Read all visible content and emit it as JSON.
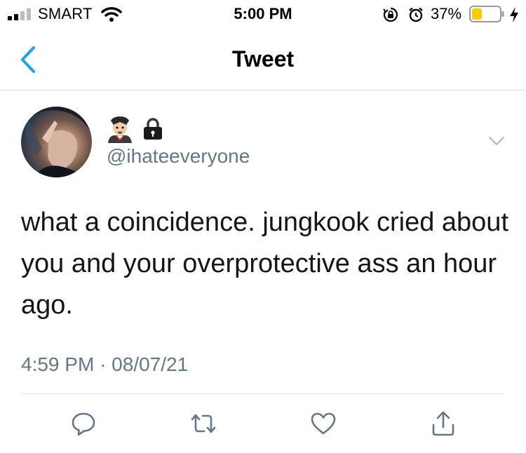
{
  "status_bar": {
    "carrier": "SMART",
    "time": "5:00 PM",
    "battery_percent": "37%",
    "battery_level": 0.37,
    "battery_color": "#ffcc00",
    "icons": [
      "signal-icon",
      "wifi-icon",
      "orientation-lock-icon",
      "alarm-icon",
      "battery-icon",
      "charging-icon"
    ]
  },
  "nav": {
    "title": "Tweet",
    "back_icon": "chevron-left-icon",
    "accent": "#1da1f2"
  },
  "tweet": {
    "display_emoji": [
      "vampire-emoji",
      "lock-emoji"
    ],
    "handle": "@ihateeveryone",
    "text": "what a coincidence. jungkook cried about you and your overprotective ass an hour ago.",
    "time": "4:59 PM",
    "separator": "·",
    "date": "08/07/21",
    "text_color": "#14171a",
    "secondary_color": "#657786"
  },
  "actions": [
    "reply-icon",
    "retweet-icon",
    "like-icon",
    "share-icon"
  ]
}
